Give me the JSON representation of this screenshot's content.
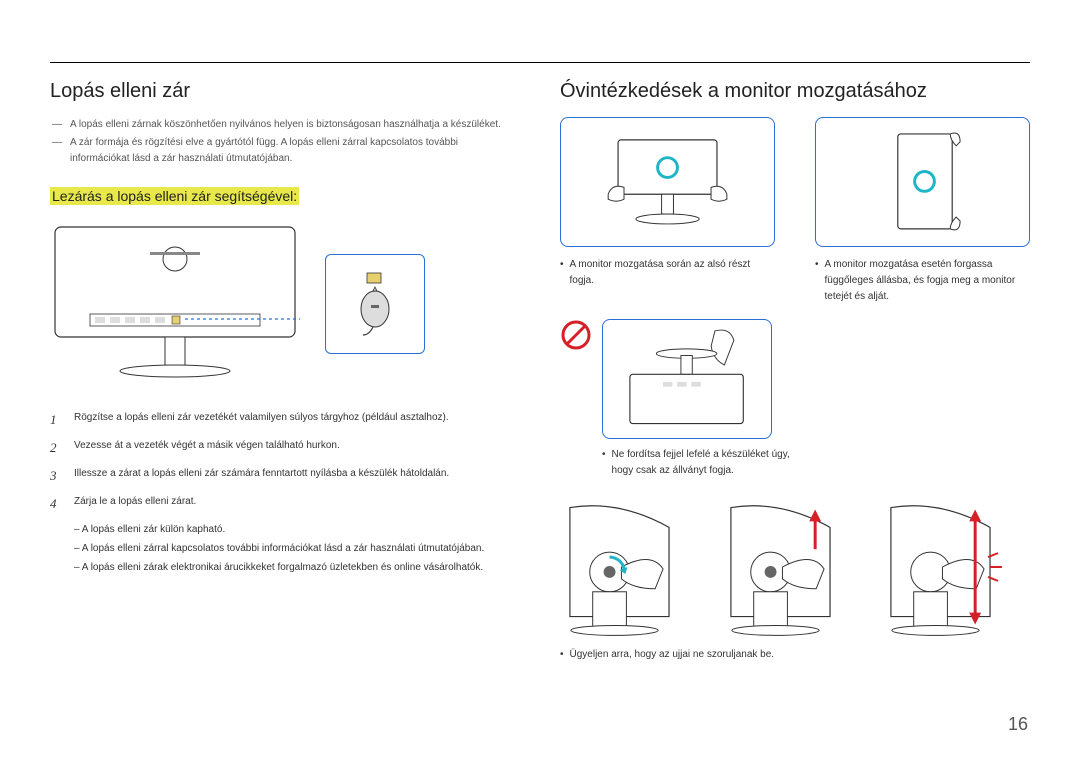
{
  "left": {
    "heading": "Lopás elleni zár",
    "notes": [
      "A lopás elleni zárnak köszönhetően nyilvános helyen is biztonságosan használhatja a készüléket.",
      "A zár formája és rögzítési elve a gyártótól függ. A lopás elleni zárral kapcsolatos további információkat lásd a zár használati útmutatójában."
    ],
    "subheading": "Lezárás a lopás elleni zár segítségével:",
    "steps": [
      "Rögzítse a lopás elleni zár vezetékét valamilyen súlyos tárgyhoz (például asztalhoz).",
      "Vezesse át a vezeték végét a másik végen található hurkon.",
      "Illessze a zárat a lopás elleni zár számára fenntartott nyílásba a készülék hátoldalán.",
      "Zárja le a lopás elleni zárat."
    ],
    "sub_items": [
      "A lopás elleni zár külön kapható.",
      "A lopás elleni zárral kapcsolatos további információkat lásd a zár használati útmutatójában.",
      "A lopás elleni zárak elektronikai árucikkeket forgalmazó üzletekben és online vásárolhatók."
    ]
  },
  "right": {
    "heading": "Óvintézkedések a monitor mozgatásához",
    "bullets_top": [
      "A monitor mozgatása során az alsó részt fogja.",
      "A monitor mozgatása esetén forgassa függőleges állásba, és fogja meg a monitor tetejét és alját."
    ],
    "bullet_mid": "Ne fordítsa fejjel lefelé a készüléket úgy, hogy csak az állványt fogja.",
    "bullet_bottom": "Ügyeljen arra, hogy az ujjai ne szoruljanak be."
  },
  "page_number": "16",
  "colors": {
    "accent": "#2a6fd6",
    "highlight": "#e8e84a",
    "warning": "#d61f26"
  }
}
